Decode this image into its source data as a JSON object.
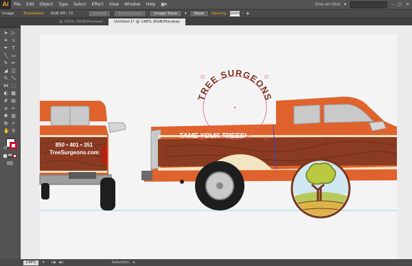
{
  "app": {
    "logo": "Ai"
  },
  "menu": [
    "File",
    "Edit",
    "Object",
    "Type",
    "Select",
    "Effect",
    "View",
    "Window",
    "Help"
  ],
  "workspace": "One-on-One",
  "control_bar": {
    "selection_type": "Image",
    "embedded": "Embedded",
    "color_mode": "RGB PPI: 72",
    "embed_button": "Embed",
    "edit_original_button": "Edit Original",
    "image_trace_button": "Image Trace",
    "mask_button": "Mask",
    "opacity_label": "Opacity:",
    "opacity_value": "100%"
  },
  "tabs": [
    "@ 150% (RGB/Preview)",
    "Untitled-1* @ 148% (RGB/Preview)"
  ],
  "artwork": {
    "arc_text": "TREE SURGEONS",
    "tagline": "TAME YOUR TREES!",
    "phone": "850 • 401 • 351",
    "website": "TreeSurgeons.com",
    "colors": {
      "orange": "#e0622c",
      "wood": "#8a3b22",
      "cream": "#f3e5c4",
      "dark": "#1e1e1e"
    }
  },
  "status": {
    "zoom": "148%",
    "tool": "Selection"
  }
}
